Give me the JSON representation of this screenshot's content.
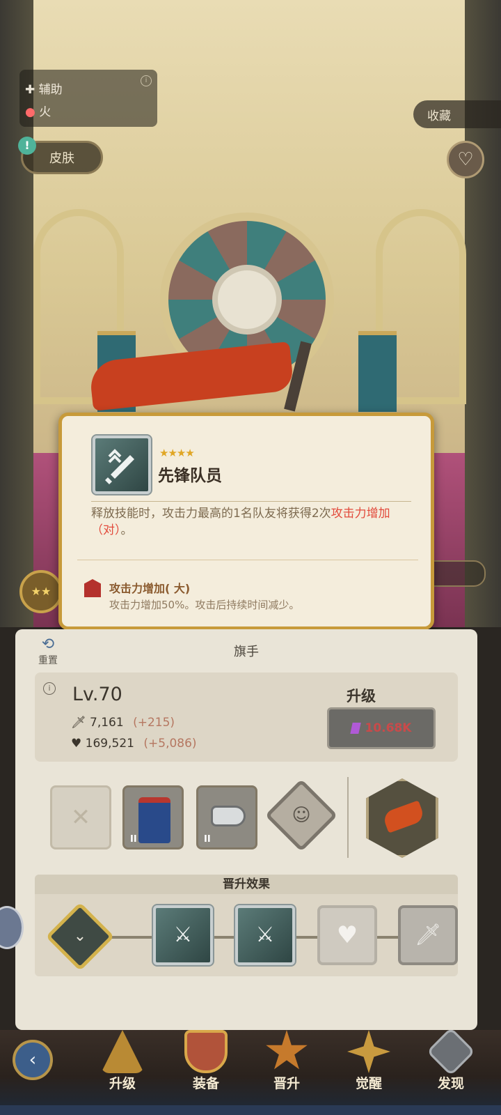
{
  "hero_info": {
    "role_label": "辅助",
    "element_label": "火",
    "skin_label": "皮肤",
    "favorite_label": "收藏"
  },
  "skill_popup": {
    "stars": "★★★★",
    "title": "先锋队员",
    "description_prefix": "释放技能时，攻击力最高的1名队友将获得2次",
    "description_highlight": "攻击力增加（对）",
    "description_suffix": "。",
    "buff_name": "攻击力增加( 大)",
    "buff_desc": "攻击力增加50%。攻击后持续时间减少。"
  },
  "hero_name": "旗手",
  "reset_label": "重置",
  "stats": {
    "level": "Lv.70",
    "attack": "7,161",
    "attack_bonus": "(+215)",
    "hp": "169,521",
    "hp_bonus": "(+5,086)"
  },
  "upgrade": {
    "label": "升级",
    "cost": "10.68K"
  },
  "equipment": {
    "badge_coat": "II",
    "badge_whistle": "II"
  },
  "promotion": {
    "title": "晋升效果"
  },
  "nav": {
    "items": [
      {
        "label": "升级"
      },
      {
        "label": "装备"
      },
      {
        "label": "晋升"
      },
      {
        "label": "觉醒"
      },
      {
        "label": "发现"
      }
    ]
  },
  "colors": {
    "highlight_red": "#e24a3b",
    "gold_border": "#c79a3a",
    "gem_purple": "#b05ad6"
  }
}
